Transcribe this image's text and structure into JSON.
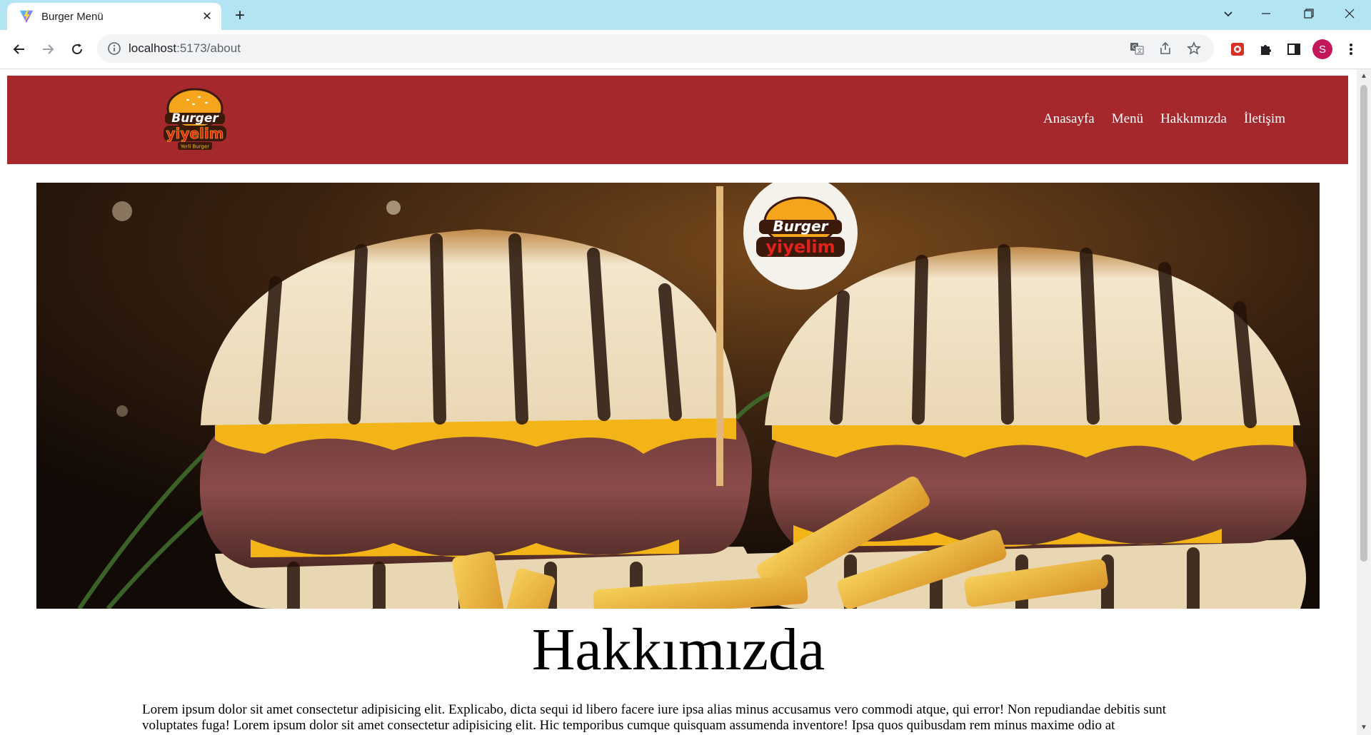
{
  "browser": {
    "tab_title": "Burger Menü",
    "url_host": "localhost",
    "url_path": ":5173/about",
    "profile_initial": "S"
  },
  "site": {
    "logo_line1": "Burger",
    "logo_line2": "yiyelim",
    "logo_tagline": "Yerli Burger",
    "nav": [
      "Anasayfa",
      "Menü",
      "Hakkımızda",
      "İletişim"
    ],
    "hero_flag_line1": "Burger",
    "hero_flag_line2": "yiyelim",
    "about_title": "Hakkımızda",
    "about_text": "Lorem ipsum dolor sit amet consectetur adipisicing elit. Explicabo, dicta sequi id libero facere iure ipsa alias minus accusamus vero commodi atque, qui error! Non repudiandae debitis sunt voluptates fuga! Lorem ipsum dolor sit amet consectetur adipisicing elit. Hic temporibus cumque quisquam assumenda inventore! Ipsa quos quibusdam rem minus maxime odio at"
  },
  "colors": {
    "header_bg": "#a4282c",
    "tabbar_bg": "#b3e4f2",
    "profile_bg": "#c2185b"
  }
}
